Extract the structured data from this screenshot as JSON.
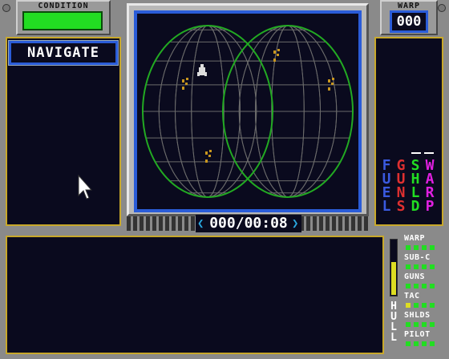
{
  "condition": {
    "label": "CONDITION",
    "color": "#22dd22"
  },
  "warp": {
    "label": "WARP",
    "value": "000"
  },
  "navigate": {
    "label": "NAVIGATE"
  },
  "timer": {
    "value": "000/00:08"
  },
  "columns": [
    {
      "letters": [
        "F",
        "U",
        "E",
        "L"
      ],
      "color": "#3a5ae0"
    },
    {
      "letters": [
        "G",
        "U",
        "N",
        "S"
      ],
      "color": "#e03030"
    },
    {
      "letters": [
        "S",
        "H",
        "L",
        "D"
      ],
      "color": "#22dd22"
    },
    {
      "letters": [
        "W",
        "A",
        "R",
        "P"
      ],
      "color": "#e020e0"
    }
  ],
  "systems": [
    {
      "label": "WARP",
      "pips": [
        "#22dd22",
        "#22dd22",
        "#22dd22",
        "#22dd22"
      ]
    },
    {
      "label": "SUB-C",
      "pips": [
        "#22dd22",
        "#22dd22",
        "#22dd22",
        "#22dd22"
      ]
    },
    {
      "label": "GUNS",
      "pips": [
        "#22dd22",
        "#22dd22",
        "#22dd22",
        "#22dd22"
      ]
    },
    {
      "label": "TAC",
      "pips": [
        "#dddd22",
        "#22dd22",
        "#22dd22",
        "#22dd22"
      ]
    },
    {
      "label": "SHLDS",
      "pips": [
        "#22dd22",
        "#22dd22",
        "#22dd22",
        "#22dd22"
      ]
    },
    {
      "label": "PILOT",
      "pips": [
        "#22dd22",
        "#22dd22",
        "#22dd22",
        "#22dd22"
      ]
    }
  ],
  "hull": {
    "letters": [
      "H",
      "U",
      "L",
      "L"
    ],
    "level": 0.6,
    "color": "#dddd22"
  },
  "map": {
    "grid_color": "#6a6a6a",
    "outline_color": "#22aa22",
    "ship_color": "#dddddd",
    "planet_color": "#c8961e"
  }
}
